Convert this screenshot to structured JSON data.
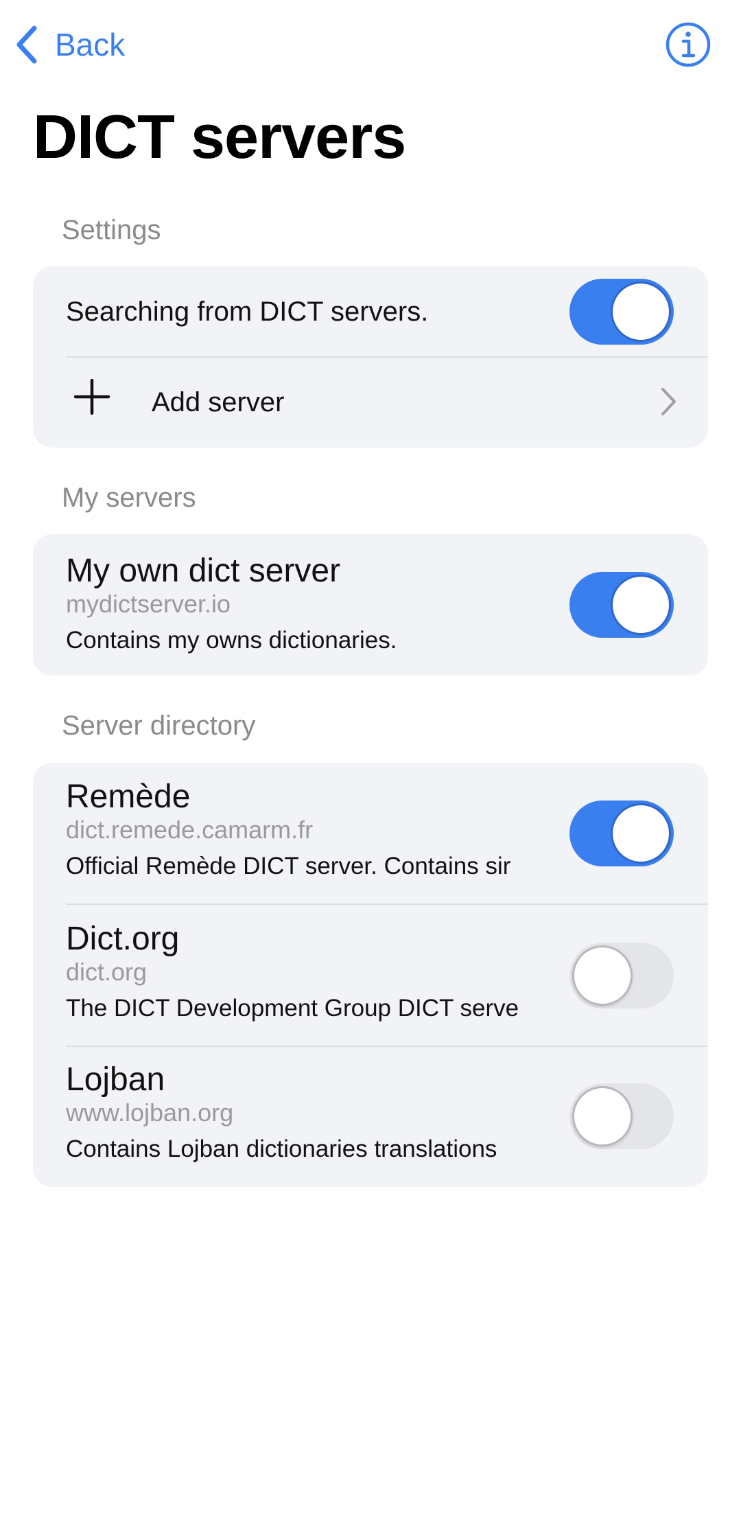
{
  "nav": {
    "back_label": "Back",
    "back_icon": "chevron-left-icon",
    "info_icon": "info-icon",
    "accent_color": "#3a7ff0"
  },
  "page": {
    "title": "DICT servers"
  },
  "settings": {
    "header": "Settings",
    "search_toggle": {
      "label": "Searching from DICT servers.",
      "enabled": true
    },
    "add_server": {
      "label": "Add server",
      "icon": "plus-icon",
      "trailing_icon": "chevron-right-icon"
    }
  },
  "my_servers": {
    "header": "My servers",
    "items": [
      {
        "name": "My own dict server",
        "host": "mydictserver.io",
        "description": "Contains my owns dictionaries.",
        "enabled": true
      }
    ]
  },
  "server_directory": {
    "header": "Server directory",
    "items": [
      {
        "name": "Remède",
        "host": "dict.remede.camarm.fr",
        "description": "Official Remède DICT server. Contains sir",
        "enabled": true
      },
      {
        "name": "Dict.org",
        "host": "dict.org",
        "description": "The DICT Development Group DICT serve",
        "enabled": false
      },
      {
        "name": "Lojban",
        "host": "www.lojban.org",
        "description": "Contains Lojban dictionaries translations",
        "enabled": false
      }
    ]
  }
}
